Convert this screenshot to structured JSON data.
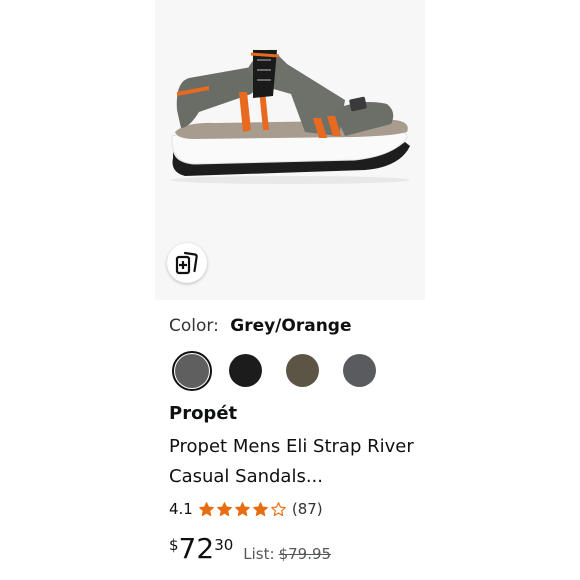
{
  "product": {
    "color_label": "Color:",
    "color_value": "Grey/Orange",
    "swatches": [
      {
        "name": "grey",
        "color": "#5f5f5f",
        "selected": true
      },
      {
        "name": "black",
        "color": "#1c1c1c",
        "selected": false
      },
      {
        "name": "brown-grey",
        "color": "#5c5546",
        "selected": false
      },
      {
        "name": "dark-grey",
        "color": "#595b5e",
        "selected": false
      }
    ],
    "brand": "Propét",
    "title": "Propet Mens Eli Strap River Casual Sandals...",
    "rating": "4.1",
    "rating_value": 4.1,
    "rating_count": "(87)",
    "price_currency": "$",
    "price_whole": "72",
    "price_fraction": "30",
    "list_label": "List:",
    "list_price": "$79.95"
  },
  "colors": {
    "star": "#e76d10",
    "accent_orange": "#e86a1f"
  },
  "icons": {
    "compare": "compare-cards-icon"
  }
}
